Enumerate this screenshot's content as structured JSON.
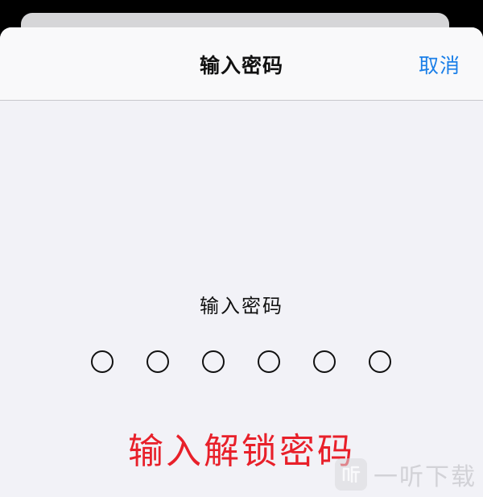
{
  "header": {
    "title": "输入密码",
    "cancel_label": "取消"
  },
  "passcode": {
    "prompt": "输入密码",
    "digits_total": 6,
    "digits_entered": 0
  },
  "annotation": {
    "text": "输入解锁密码",
    "color": "#e8202a"
  },
  "watermark": {
    "text": "一听下载"
  },
  "colors": {
    "accent": "#1a7fe8",
    "background": "#f2f2f7"
  }
}
